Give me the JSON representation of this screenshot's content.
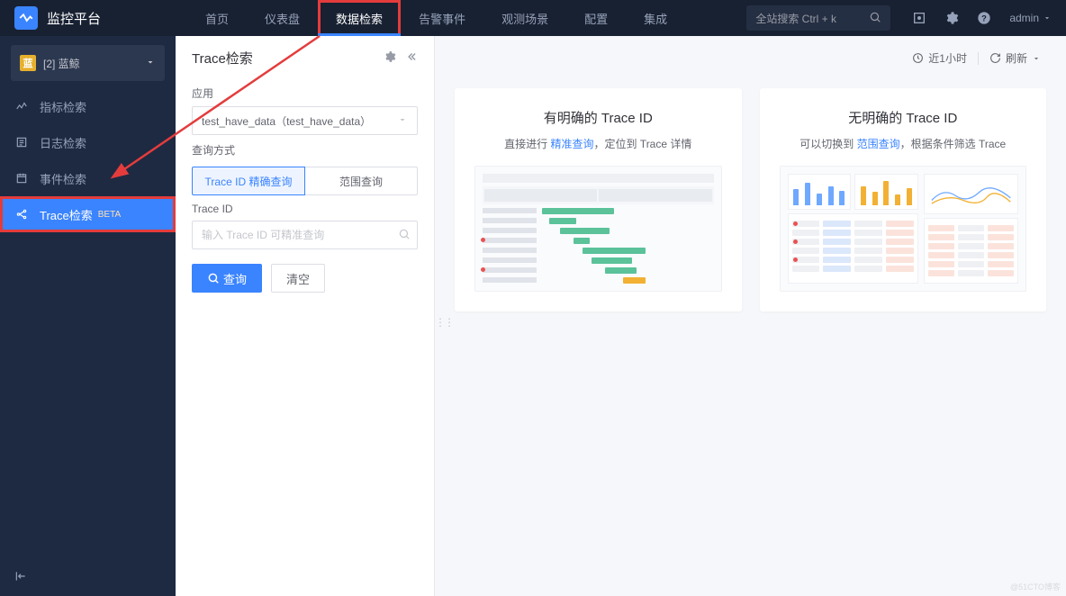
{
  "brand": "监控平台",
  "nav": [
    "首页",
    "仪表盘",
    "数据检索",
    "告警事件",
    "观测场景",
    "配置",
    "集成"
  ],
  "nav_active_index": 2,
  "search_placeholder": "全站搜索 Ctrl + k",
  "admin_label": "admin",
  "biz": {
    "badge": "蓝",
    "label": "[2] 蓝鲸"
  },
  "sidebar": [
    {
      "label": "指标检索",
      "icon": "metric"
    },
    {
      "label": "日志检索",
      "icon": "log"
    },
    {
      "label": "事件检索",
      "icon": "event"
    },
    {
      "label": "Trace检索",
      "icon": "trace",
      "beta": "BETA",
      "active": true
    }
  ],
  "panel": {
    "title": "Trace检索",
    "app_label": "应用",
    "app_value": "test_have_data（test_have_data）",
    "method_label": "查询方式",
    "tabs": [
      "Trace ID 精确查询",
      "范围查询"
    ],
    "tab_active": 0,
    "traceid_label": "Trace ID",
    "traceid_placeholder": "输入 Trace ID 可精准查询",
    "query_btn": "查询",
    "clear_btn": "清空"
  },
  "toolbar": {
    "time": "近1小时",
    "refresh": "刷新"
  },
  "cards": [
    {
      "title": "有明确的 Trace ID",
      "sub_pre": "直接进行 ",
      "sub_link": "精准查询",
      "sub_post": "，定位到 Trace 详情"
    },
    {
      "title": "无明确的 Trace ID",
      "sub_pre": "可以切换到 ",
      "sub_link": "范围查询",
      "sub_post": "，根据条件筛选 Trace"
    }
  ],
  "watermark": "@51CTO博客"
}
